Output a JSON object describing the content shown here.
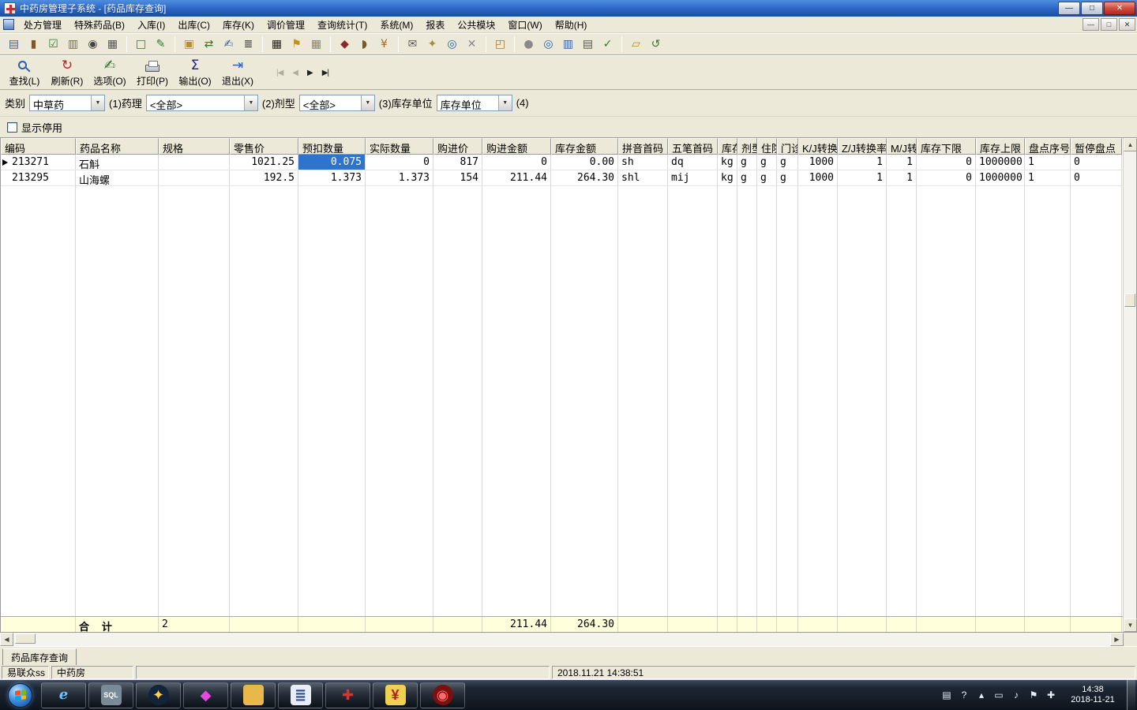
{
  "window": {
    "title": "中药房管理子系统 - [药品库存查询]",
    "controls": {
      "minimize": "—",
      "maximize": "□",
      "close": "✕"
    },
    "mdi_controls": {
      "minimize": "—",
      "restore": "□",
      "close": "✕"
    }
  },
  "menu": {
    "items": [
      "处方管理",
      "特殊药品(B)",
      "入库(I)",
      "出库(C)",
      "库存(K)",
      "调价管理",
      "查询统计(T)",
      "系统(M)",
      "报表",
      "公共模块",
      "窗口(W)",
      "帮助(H)"
    ]
  },
  "toolbar": [
    {
      "name": "print-report-icon",
      "glyph": "▤",
      "color": "#3a5fa0"
    },
    {
      "name": "stock-book-icon",
      "glyph": "▮",
      "color": "#7a5a2a"
    },
    {
      "name": "audit-sheet-icon",
      "glyph": "☑",
      "color": "#2a7a2a"
    },
    {
      "name": "find-book-icon",
      "glyph": "▥",
      "color": "#8a6a2a"
    },
    {
      "name": "binoculars-icon",
      "glyph": "◉",
      "color": "#444444"
    },
    {
      "name": "browse-icon",
      "glyph": "▦",
      "color": "#555566"
    },
    {
      "sep": true
    },
    {
      "name": "new-doc-icon",
      "glyph": "□",
      "color": "#3a5fa0"
    },
    {
      "name": "sign-doc-icon",
      "glyph": "✎",
      "color": "#2a7a2a"
    },
    {
      "sep": true
    },
    {
      "name": "copy-doc-icon",
      "glyph": "▣",
      "color": "#b0922a"
    },
    {
      "name": "transfer-icon",
      "glyph": "⇄",
      "color": "#2a7a2a"
    },
    {
      "name": "edit-sheet-icon",
      "glyph": "✍",
      "color": "#3a5fa0"
    },
    {
      "name": "terminal-icon",
      "glyph": "≣",
      "color": "#333333"
    },
    {
      "sep": true
    },
    {
      "name": "barcode-icon",
      "glyph": "▦",
      "color": "#222222"
    },
    {
      "name": "alert-bell-icon",
      "glyph": "⚑",
      "color": "#c09020"
    },
    {
      "name": "calendar-icon",
      "glyph": "▦",
      "color": "#b08020"
    },
    {
      "sep": true
    },
    {
      "name": "lock-icon",
      "glyph": "◆",
      "color": "#8a2a2a"
    },
    {
      "name": "purse-icon",
      "glyph": "◗",
      "color": "#7a5a2a"
    },
    {
      "name": "cash-icon",
      "glyph": "¥",
      "color": "#a06a1a"
    },
    {
      "sep": true
    },
    {
      "name": "mail-icon",
      "glyph": "✉",
      "color": "#555555"
    },
    {
      "name": "key-icon",
      "glyph": "✦",
      "color": "#b08a2a"
    },
    {
      "name": "zoom-icon",
      "glyph": "◎",
      "color": "#2a5fb0"
    },
    {
      "name": "close-doc-icon",
      "glyph": "✕",
      "color": "#888888"
    },
    {
      "sep": true
    },
    {
      "name": "open-box-icon",
      "glyph": "◰",
      "color": "#b07a2a"
    },
    {
      "sep": true
    },
    {
      "name": "globe-icon",
      "glyph": "●",
      "color": "#8a8a8a"
    },
    {
      "name": "search-icon",
      "glyph": "◎",
      "color": "#2a5fb0"
    },
    {
      "name": "columns-icon",
      "glyph": "▥",
      "color": "#3a5fa0"
    },
    {
      "name": "print-list-icon",
      "glyph": "▤",
      "color": "#555566"
    },
    {
      "name": "verify-doc-icon",
      "glyph": "✓",
      "color": "#2a7a2a"
    },
    {
      "sep": true
    },
    {
      "name": "basket-icon",
      "glyph": "▱",
      "color": "#b08a2a"
    },
    {
      "name": "recycle-icon",
      "glyph": "↺",
      "color": "#2a7a2a"
    }
  ],
  "actions": [
    {
      "name": "find-button",
      "label": "查找(L)",
      "icon": "css-magnifier"
    },
    {
      "name": "refresh-button",
      "label": "刷新(R)",
      "glyph": "↻",
      "color": "#c02020"
    },
    {
      "name": "options-button",
      "label": "选项(O)",
      "glyph": "✍",
      "color": "#2a6a2a"
    },
    {
      "name": "print-button",
      "label": "打印(P)",
      "icon": "css-printer"
    },
    {
      "name": "export-button",
      "label": "输出(O)",
      "glyph": "Σ",
      "color": "#1a1a8c"
    },
    {
      "name": "exit-button",
      "label": "退出(X)",
      "glyph": "⇥",
      "color": "#2a5fb0"
    }
  ],
  "nav": [
    {
      "name": "first-record-button",
      "glyph": "|◀",
      "enabled": false
    },
    {
      "name": "prev-record-button",
      "glyph": "◀",
      "enabled": false
    },
    {
      "name": "next-record-button",
      "glyph": "▶",
      "enabled": true
    },
    {
      "name": "last-record-button",
      "glyph": "▶|",
      "enabled": true
    }
  ],
  "filters": {
    "category": {
      "label": "类别",
      "value": "中草药"
    },
    "pharmacology": {
      "label": "(1)药理",
      "value": "<全部>"
    },
    "dosage_form": {
      "label": "(2)剂型",
      "value": "<全部>"
    },
    "stock_unit": {
      "label": "(3)库存单位",
      "value": "库存单位"
    },
    "trailing_label": "(4)"
  },
  "show_disabled_label": "显示停用",
  "grid": {
    "columns": [
      "编码",
      "药品名称",
      "规格",
      "零售价",
      "预扣数量",
      "实际数量",
      "购进价",
      "购进金额",
      "库存金额",
      "拼音首码",
      "五笔首码",
      "库存单位",
      "剂型",
      "住院",
      "门诊",
      "K/J转换率",
      "Z/J转换率",
      "M/J转换率",
      "库存下限",
      "库存上限",
      "盘点序号",
      "暂停盘点"
    ],
    "rows": [
      [
        "213271",
        "石斛",
        "",
        "1021.25",
        "0.075",
        "0",
        "817",
        "0",
        "0.00",
        "sh",
        "dq",
        "kg",
        "g",
        "g",
        "g",
        "1000",
        "1",
        "1",
        "0",
        "1000000",
        "1",
        "0"
      ],
      [
        "213295",
        "山海螺",
        "",
        "192.5",
        "1.373",
        "1.373",
        "154",
        "211.44",
        "264.30",
        "shl",
        "mij",
        "kg",
        "g",
        "g",
        "g",
        "1000",
        "1",
        "1",
        "0",
        "1000000",
        "1",
        "0"
      ]
    ],
    "summary": [
      "",
      "合 计",
      "2",
      "",
      "",
      "",
      "",
      "211.44",
      "264.30",
      "",
      "",
      "",
      "",
      "",
      "",
      "",
      "",
      "",
      "",
      "",
      "",
      ""
    ],
    "selection": {
      "row": 0,
      "col": 4
    },
    "selection_color": "#2e74cf",
    "summary_bg": "#ffffdc"
  },
  "bottom_tab": "药品库存查询",
  "statusbar": {
    "panel1": "易联众ss",
    "panel2": "中药房",
    "datetime": "2018.11.21 14:38:51"
  },
  "taskbar": {
    "apps": [
      {
        "name": "taskbar-app-ie",
        "glyph": "e",
        "fg": "#6fc3ff",
        "italic": true
      },
      {
        "name": "taskbar-app-sql-tool",
        "glyph": "SQL",
        "fg": "#ffffff",
        "bg": "#7a8a99",
        "small": true
      },
      {
        "name": "taskbar-app-compass",
        "glyph": "✦",
        "fg": "#ffd24a",
        "bg": "#12233a",
        "round": true
      },
      {
        "name": "taskbar-app-gem",
        "glyph": "◆",
        "fg": "#e24ae0"
      },
      {
        "name": "taskbar-app-folder",
        "glyph": "",
        "fg": "#ffffff",
        "bg": "#e8b84a"
      },
      {
        "name": "taskbar-app-notepad",
        "glyph": "≣",
        "fg": "#2a4a8a",
        "bg": "#e8eef8"
      },
      {
        "name": "taskbar-app-red-cross",
        "glyph": "✚",
        "fg": "#e03030"
      },
      {
        "name": "taskbar-app-cashier",
        "glyph": "¥",
        "fg": "#b02020",
        "bg": "#f0d050"
      },
      {
        "name": "taskbar-app-pharmacy",
        "glyph": "◉",
        "fg": "#ff6a6a",
        "bg": "#7a1010",
        "round": true
      }
    ],
    "tray": [
      {
        "name": "tray-ime-icon",
        "glyph": "▤"
      },
      {
        "name": "tray-help-icon",
        "glyph": "?"
      },
      {
        "name": "tray-hidden-icons-chevron",
        "glyph": "▴"
      },
      {
        "name": "tray-display-icon",
        "glyph": "▭"
      },
      {
        "name": "tray-volume-icon",
        "glyph": "♪"
      },
      {
        "name": "tray-network-icon",
        "glyph": "⚑"
      },
      {
        "name": "tray-usb-icon",
        "glyph": "✚"
      }
    ],
    "clock": {
      "time": "14:38",
      "date": "2018-11-21"
    }
  }
}
